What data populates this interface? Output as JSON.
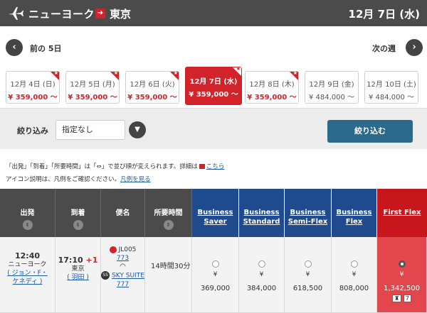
{
  "header": {
    "origin": "ニューヨーク",
    "arrow": "➔",
    "destination": "東京",
    "date": "12月 7日 (水)"
  },
  "nav": {
    "prev_label": "前の 5日",
    "next_label": "次の週",
    "prev_icon": "‹",
    "next_icon": "›"
  },
  "date_tabs": [
    {
      "date": "12月 4日 (日)",
      "price": "¥ 359,000 ～",
      "special": true
    },
    {
      "date": "12月 5日 (月)",
      "price": "¥ 359,000 ～",
      "special": true
    },
    {
      "date": "12月 6日 (火)",
      "price": "¥ 359,000 ～",
      "special": true
    },
    {
      "date": "12月 7日 (水)",
      "price": "¥ 359,000 ～",
      "special": true
    },
    {
      "date": "12月 8日 (木)",
      "price": "¥ 359,000 ～",
      "special": true
    },
    {
      "date": "12月 9日 (金)",
      "price": "¥ 484,000 ～",
      "special": false
    },
    {
      "date": "12月 10日 (土)",
      "price": "¥ 484,000 ～",
      "special": false
    }
  ],
  "filter": {
    "title": "絞り込み",
    "select_value": "指定なし",
    "button_label": "絞り込む"
  },
  "notes": {
    "line1": "「出発」「到着」「所要時間」は「⇔」で並び順が変えられます。詳細は",
    "line1_link": "こちら",
    "line2": "アイコン説明は、凡例をご確認ください。",
    "line2_link": "凡例を見る"
  },
  "table": {
    "headers": {
      "departure": "出発",
      "arrival": "到着",
      "flight": "便名",
      "duration": "所要時間"
    },
    "fares": [
      {
        "line1": "Business",
        "line2": "Saver"
      },
      {
        "line1": "Business",
        "line2": "Standard"
      },
      {
        "line1": "Business",
        "line2": "Semi-Flex"
      },
      {
        "line1": "Business",
        "line2": "Flex"
      },
      {
        "line1": "First Flex",
        "line2": ""
      }
    ],
    "row": {
      "dep_time": "12:40",
      "dep_city": "ニューヨーク",
      "dep_airport_line1": "( ジョン・F・",
      "dep_airport_line2": "ケネディ )",
      "arr_time": "17:10",
      "arr_plus": "+1",
      "arr_city": "東京",
      "arr_airport": "( 羽田 )",
      "flight_no": "JL005",
      "aircraft": "773",
      "seat_brand": "SKY SUITE 777",
      "duration": "14時間30分",
      "prices": [
        "369,000",
        "384,000",
        "618,500",
        "808,000",
        "1,342,500"
      ],
      "yen": "¥",
      "first_seats": "7"
    }
  },
  "colors": {
    "header_bg": "#4b4b4b",
    "accent_red": "#d2232a",
    "fare_blue": "#1f4a8e",
    "filter_button": "#2b6a8a"
  }
}
